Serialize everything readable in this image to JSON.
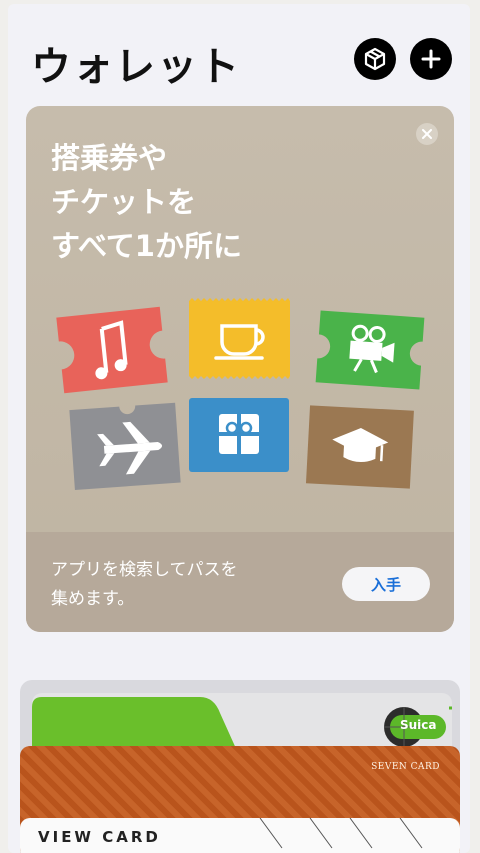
{
  "header": {
    "title": "ウォレット",
    "package_icon": "package-icon",
    "add_icon": "plus-icon"
  },
  "promo": {
    "headline": "搭乗券や\nチケットを\nすべて1か所に",
    "description": "アプリを検索してパスを\n集めます。",
    "get_label": "入手",
    "close_icon": "close-icon",
    "ticket_icons": [
      "music-note-icon",
      "coffee-cup-icon",
      "movie-camera-icon",
      "airplane-icon",
      "gift-icon",
      "graduation-cap-icon"
    ]
  },
  "passes": {
    "suica_logo_text": "Suica",
    "seven_card_label": "SEVEN CARD",
    "view_card_label": "VIEW CARD"
  },
  "colors": {
    "promo_bg": "#c6bcac",
    "get_text": "#1a6fd8",
    "ticket_red": "#e8635a",
    "ticket_yellow": "#f4bd2a",
    "ticket_green": "#4ab34a",
    "ticket_gray": "#8f9094",
    "ticket_blue": "#3b8fc9",
    "ticket_brown": "#9b7852"
  }
}
